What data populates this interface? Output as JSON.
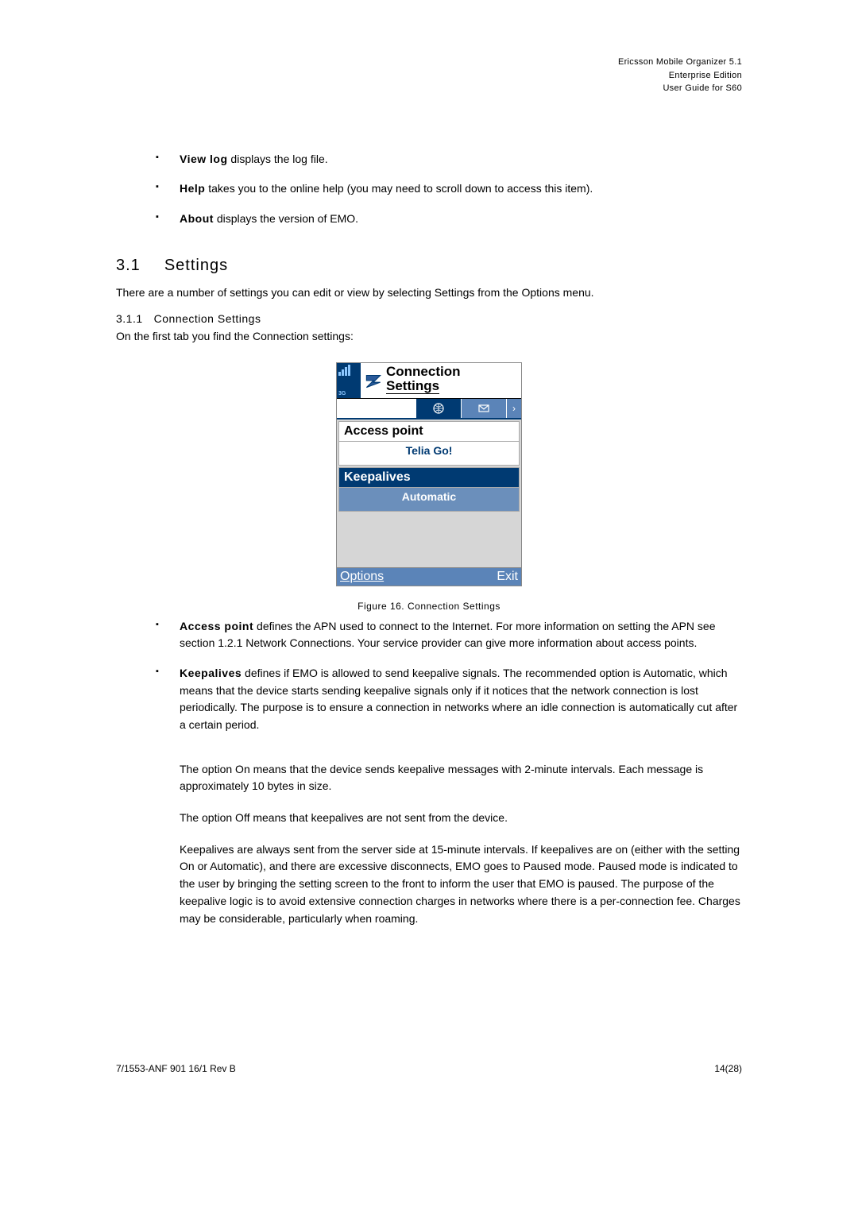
{
  "header": {
    "line1": "Ericsson Mobile Organizer 5.1",
    "line2": "Enterprise Edition",
    "line3": "User Guide for S60"
  },
  "intro_bullets": [
    {
      "term": "View log",
      "text": " displays the log file."
    },
    {
      "term": "Help",
      "text": " takes you to the online help (you may need to scroll down to access this item)."
    },
    {
      "term": "About",
      "text": " displays the version of EMO."
    }
  ],
  "section": {
    "num": "3.1",
    "title": "Settings",
    "intro": "There are a number of settings you can edit or view by selecting Settings from the Options menu.",
    "sub_num": "3.1.1",
    "sub_title": "Connection Settings",
    "sub_intro": "On the first tab you find the Connection settings:"
  },
  "phone": {
    "title_line1": "Connection",
    "title_line2": "Settings",
    "sig_label": "3G",
    "arrow": "›",
    "access_point_label": "Access point",
    "access_point_value": "Telia Go!",
    "keepalives_label": "Keepalives",
    "keepalives_value": "Automatic",
    "left_sk": "Options",
    "right_sk": "Exit"
  },
  "caption": "Figure 16. Connection Settings",
  "body_bullets": [
    {
      "term": "Access point",
      "text": " defines the APN used to connect to the Internet. For more information on setting the APN see section 1.2.1 Network Connections. Your service provider can give more information about access points."
    },
    {
      "term": "Keepalives",
      "text": " defines if EMO is allowed to send keepalive signals. The recommended option is Automatic, which means that the device starts sending keepalive signals only if it notices that the network connection is lost periodically. The purpose is to ensure a connection in networks where an idle connection is automatically cut after a certain period."
    }
  ],
  "paras": {
    "p1": "The option On means that the device sends keepalive messages with 2-minute intervals. Each message is approximately 10 bytes in size.",
    "p2": "The option Off means that keepalives are not sent from the device.",
    "p3": "Keepalives are always sent from the server side at 15-minute intervals. If keepalives are on (either with the setting On or Automatic), and there are excessive disconnects, EMO goes to Paused mode. Paused mode is indicated to the user by bringing the setting screen to the front to inform the user that EMO is paused. The purpose of the keepalive logic is to avoid extensive connection charges in networks where there is a per-connection fee. Charges may be considerable, particularly when roaming."
  },
  "footer": {
    "left": "7/1553-ANF 901 16/1 Rev B",
    "right": "14(28)"
  }
}
